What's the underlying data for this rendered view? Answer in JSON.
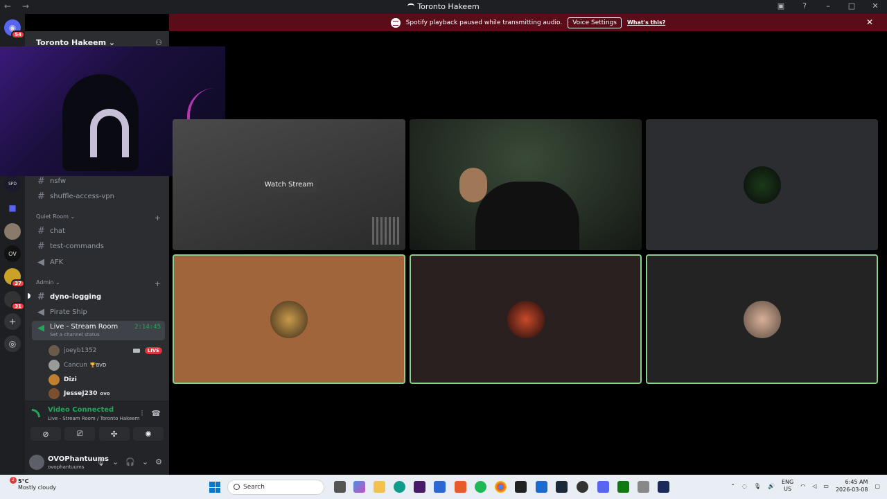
{
  "window": {
    "title": "Toronto Hakeem"
  },
  "notice": {
    "message": "Spotify playback paused while transmitting audio.",
    "button": "Voice Settings",
    "link": "What's this?"
  },
  "rail": {
    "top_badge": "54",
    "badge_37": "37",
    "badge_31": "31"
  },
  "server": {
    "name": "Toronto Hakeem"
  },
  "channels": {
    "nsfw": "nsfw",
    "shuffle": "shuffle-access-vpn",
    "quiet_room": "Quiet Room",
    "chat": "chat",
    "test_commands": "test-commands",
    "afk": "AFK",
    "admin": "Admin",
    "dyno_logging": "dyno-logging",
    "pirate_ship": "Pirate Ship",
    "live_room": "Live - Stream Room",
    "live_timer": "2:14:45",
    "live_status": "Set a channel status"
  },
  "voice_users": [
    {
      "name": "joeyb1352",
      "tag": "",
      "live": "LIVE"
    },
    {
      "name": "Cancun",
      "tag": "🏆BVD"
    },
    {
      "name": "Dizi",
      "tag": ""
    },
    {
      "name": "JesseJ230",
      "tag": "ovo"
    }
  ],
  "voice_panel": {
    "title": "Video Connected",
    "subtitle": "Live - Stream Room / Toronto Hakeem"
  },
  "user": {
    "display": "OVOPhantuums",
    "username": "ovophantuums"
  },
  "stage": {
    "watch_label": "Watch Stream"
  },
  "taskbar": {
    "temp": "5°C",
    "weather": "Mostly cloudy",
    "weather_badge": "2",
    "search": "Search",
    "lang1": "ENG",
    "lang2": "US",
    "time": "6:45 AM",
    "date": "2026-03-08"
  },
  "colors": {
    "accent_green": "#23a55a",
    "notice_bg": "#5a0c18",
    "live_red": "#da373c"
  }
}
